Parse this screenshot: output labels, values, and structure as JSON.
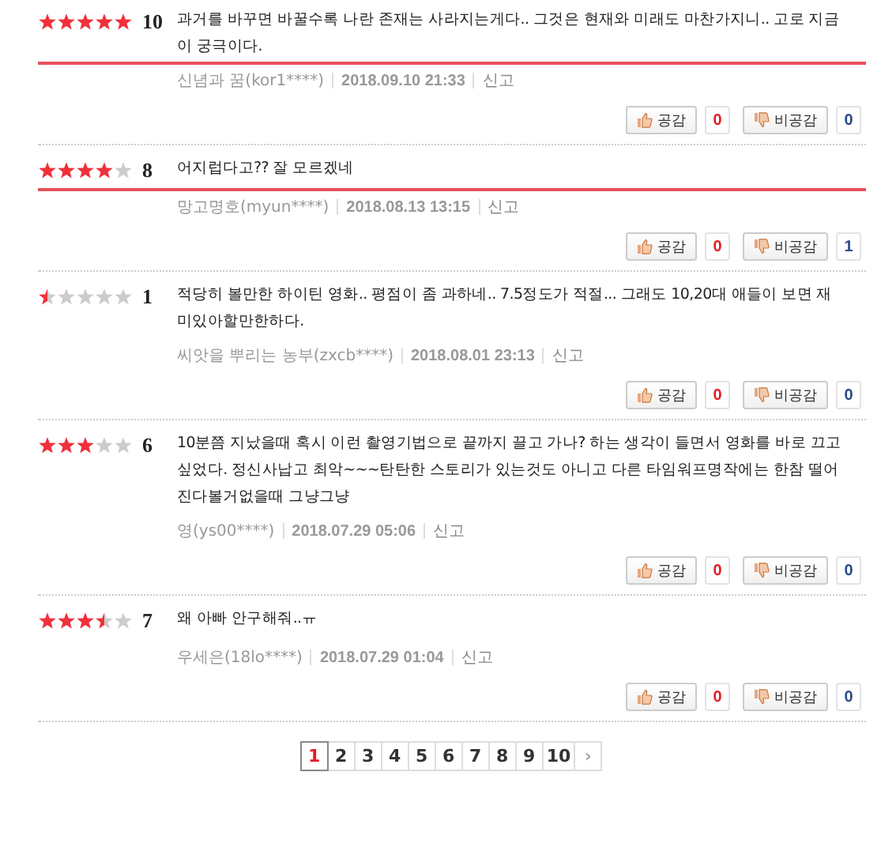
{
  "reviews": [
    {
      "stars": 5,
      "score": "10",
      "highlighted": true,
      "text": "과거를 바꾸면 바꿀수록 나란 존재는 사라지는게다.. 그것은 현재와 미래도 마찬가지니.. 고로 지금이 궁극이다.",
      "author": "신념과 꿈(kor1****)",
      "date": "2018.09.10 21:33",
      "report": "신고",
      "like_label": "공감",
      "likes": "0",
      "dislike_label": "비공감",
      "dislikes": "0"
    },
    {
      "stars": 4,
      "score": "8",
      "highlighted": true,
      "text": "어지럽다고?? 잘 모르겠네",
      "author": "망고명호(myun****)",
      "date": "2018.08.13 13:15",
      "report": "신고",
      "like_label": "공감",
      "likes": "0",
      "dislike_label": "비공감",
      "dislikes": "1"
    },
    {
      "stars": 0.5,
      "score": "1",
      "highlighted": false,
      "text": "적당히 볼만한 하이틴 영화.. 평점이 좀 과하네.. 7.5정도가 적절... 그래도 10,20대 애들이 보면 재미있아할만한하다.",
      "author": "씨앗을 뿌리는 농부(zxcb****)",
      "date": "2018.08.01 23:13",
      "report": "신고",
      "like_label": "공감",
      "likes": "0",
      "dislike_label": "비공감",
      "dislikes": "0"
    },
    {
      "stars": 3,
      "score": "6",
      "highlighted": false,
      "text": "10분쯤 지났을때 혹시 이런 촬영기법으로 끝까지 끌고 가나? 하는 생각이 들면서 영화를 바로 끄고 싶었다. 정신사납고 최악~~~탄탄한 스토리가 있는것도 아니고 다른 타임워프명작에는 한참 떨어진다볼거없을때 그냥그냥",
      "author": "영(ys00****)",
      "date": "2018.07.29 05:06",
      "report": "신고",
      "like_label": "공감",
      "likes": "0",
      "dislike_label": "비공감",
      "dislikes": "0"
    },
    {
      "stars": 3.5,
      "score": "7",
      "highlighted": false,
      "text": "왜 아빠 안구해줘..ㅠ",
      "author": "우세은(18lo****)",
      "date": "2018.07.29 01:04",
      "report": "신고",
      "like_label": "공감",
      "likes": "0",
      "dislike_label": "비공감",
      "dislikes": "0"
    }
  ],
  "pagination": {
    "pages": [
      {
        "label": "1",
        "selected": true
      },
      {
        "label": "2",
        "selected": false
      },
      {
        "label": "3",
        "selected": false
      },
      {
        "label": "4",
        "selected": false
      },
      {
        "label": "5",
        "selected": false
      },
      {
        "label": "6",
        "selected": false
      },
      {
        "label": "7",
        "selected": false
      },
      {
        "label": "8",
        "selected": false
      },
      {
        "label": "9",
        "selected": false
      },
      {
        "label": "10",
        "selected": false
      }
    ],
    "next": "›"
  }
}
